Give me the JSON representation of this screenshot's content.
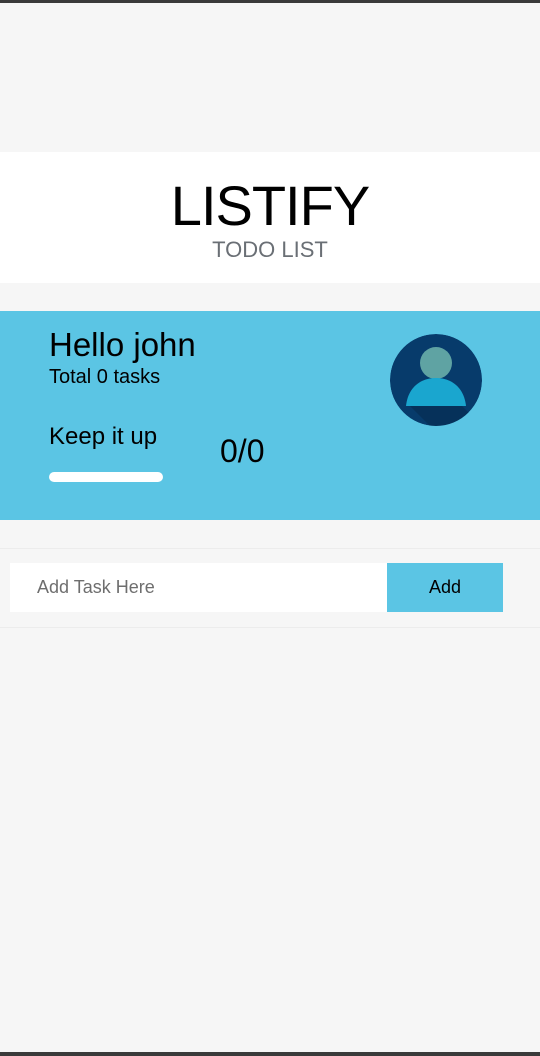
{
  "header": {
    "title": "LISTIFY",
    "subtitle": "TODO LIST"
  },
  "summary": {
    "greeting": "Hello john",
    "total_tasks": "Total 0 tasks",
    "motivation": "Keep it up",
    "progress_fraction": 0,
    "counter": "0/0",
    "avatar_icon": "user-avatar-icon"
  },
  "task_form": {
    "placeholder": "Add Task Here",
    "value": "",
    "add_label": "Add"
  },
  "colors": {
    "accent": "#5bc5e4",
    "background": "#f6f6f6",
    "avatar_background": "#073b6b",
    "avatar_head": "#5fa3a3",
    "avatar_body": "#1aa6cf"
  }
}
